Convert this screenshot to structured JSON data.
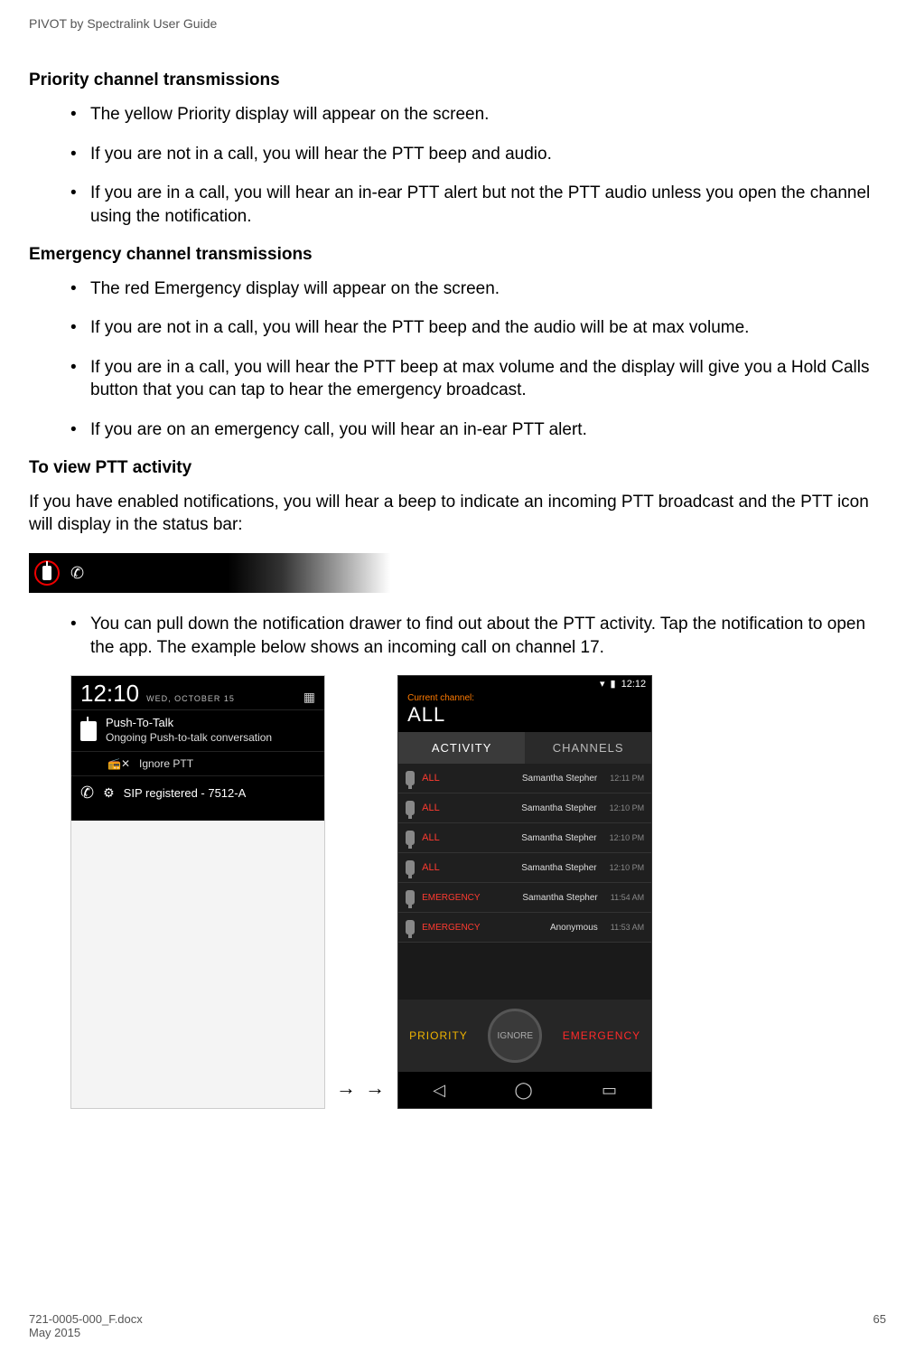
{
  "header": {
    "guide": "PIVOT by Spectralink User Guide"
  },
  "sections": {
    "priority": {
      "title": "Priority channel transmissions",
      "items": [
        "The yellow Priority display will appear on the screen.",
        "If you are not in a call, you will hear the PTT beep and audio.",
        "If you are in a call, you will hear an in-ear PTT alert but not the PTT audio unless you open the channel using the notification."
      ]
    },
    "emergency": {
      "title": "Emergency channel transmissions",
      "items": [
        "The red Emergency display will appear on the screen.",
        "If you are not in a call, you will hear the PTT beep and the audio will be at max volume.",
        "If you are in a call, you will hear the PTT beep at max volume and the display will give you a Hold Calls button that you can tap to hear the emergency broadcast.",
        "If you are on an emergency call, you will hear an in-ear PTT alert."
      ]
    },
    "view": {
      "title": "To view PTT activity",
      "intro": "If you have enabled notifications, you will hear a beep to indicate an incoming PTT broadcast and the PTT icon will display in the status bar:",
      "item": "You can pull down the notification drawer to find out about the PTT activity. Tap the notification to open the app. The example below shows an incoming call on channel 17."
    }
  },
  "arrows": "→ →",
  "phone1": {
    "time": "12:10",
    "date": "WED, OCTOBER 15",
    "notif_title": "Push-To-Talk",
    "notif_body": "Ongoing Push-to-talk conversation",
    "ignore": "Ignore PTT",
    "sip": "SIP registered - 7512-A"
  },
  "phone2": {
    "status_time": "12:12",
    "current_label": "Current channel:",
    "current_channel": "ALL",
    "tabs": {
      "activity": "ACTIVITY",
      "channels": "CHANNELS"
    },
    "rows": [
      {
        "ch": "ALL",
        "caller": "Samantha Stepher",
        "ts": "12:11 PM"
      },
      {
        "ch": "ALL",
        "caller": "Samantha Stepher",
        "ts": "12:10 PM"
      },
      {
        "ch": "ALL",
        "caller": "Samantha Stepher",
        "ts": "12:10 PM"
      },
      {
        "ch": "ALL",
        "caller": "Samantha Stepher",
        "ts": "12:10 PM"
      },
      {
        "ch": "EMERGENCY",
        "caller": "Samantha Stepher",
        "ts": "11:54 AM"
      },
      {
        "ch": "EMERGENCY",
        "caller": "Anonymous",
        "ts": "11:53 AM"
      }
    ],
    "buttons": {
      "priority": "PRIORITY",
      "ignore": "IGNORE",
      "emergency": "EMERGENCY"
    }
  },
  "footer": {
    "docx": "721-0005-000_F.docx",
    "date": "May 2015",
    "page": "65"
  }
}
